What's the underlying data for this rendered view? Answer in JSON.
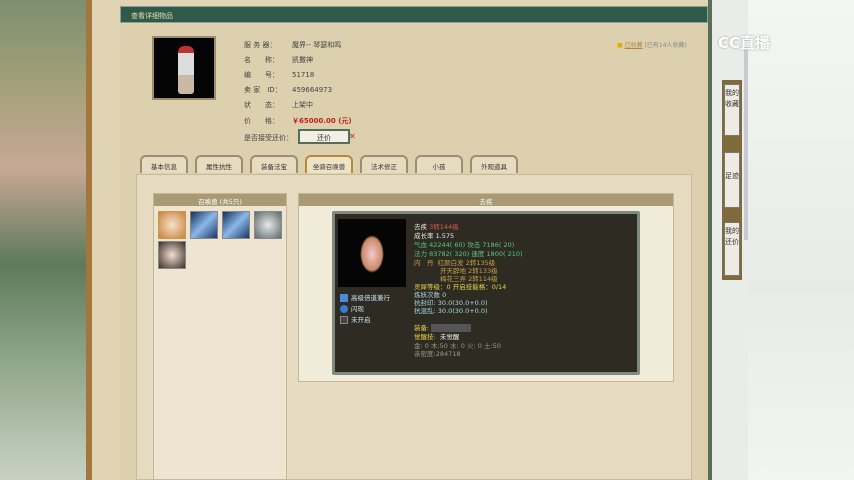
{
  "header": {
    "title": "查看详细物品"
  },
  "info": {
    "server_label": "服 务 器：",
    "server": "魔界-- 琴瑟和鸣",
    "name_label": "名　　称：",
    "name": "凯撒神",
    "id_label": "编　　号：",
    "id": "51718",
    "seller_label": "卖 家　ID：",
    "seller": "459664973",
    "status_label": "状　　态：",
    "status": "上架中",
    "price_label": "价　　格：",
    "price": "￥65000.00 (元)",
    "counter_label": "是否接受还价：",
    "counter_button": "还价",
    "counter_mark": "✕"
  },
  "favorite": {
    "link": "已收藏",
    "count": "(已有14人收藏)"
  },
  "tabs": [
    "基本信息",
    "属性抗性",
    "装备法宝",
    "坐骑召唤兽",
    "法术修正",
    "小孩",
    "外观道具"
  ],
  "active_tab": 3,
  "pets": {
    "title": "召唤兽 (共5只)"
  },
  "detail": {
    "title": "去疾",
    "name": "去疾",
    "rank": "3转144级",
    "growth": "成长率 1.575",
    "line1": "气血 42244( 60) 攻击 7186( 20)",
    "line2": "法力 83782( 320) 速度 1800( 210)",
    "neidan_label": "内　丹",
    "neidan": [
      "红颜白发 2转135级",
      "开天辟地 2转133级",
      "梅花三弄 2转114级"
    ],
    "lingxi": "灵犀等级：0 开启技能格：0/14",
    "lianyao": "炼妖次数 0",
    "kangfeng": "抗封印: 30.0(30.0+0.0)",
    "kanghun": "抗混乱: 30.0(30.0+0.0)",
    "equip_label": "装备:",
    "awaken_label": "觉醒技:",
    "awaken": "未觉醒",
    "elements": "金: 0 木:50 水: 0 火: 0 土:50",
    "intimacy": "亲密度:284718",
    "skills": [
      "高级倍道兼行",
      "闪现",
      "未开启"
    ]
  },
  "sidebar": [
    "我的收藏",
    "足迹",
    "我的还价"
  ],
  "logo": "CC直播"
}
